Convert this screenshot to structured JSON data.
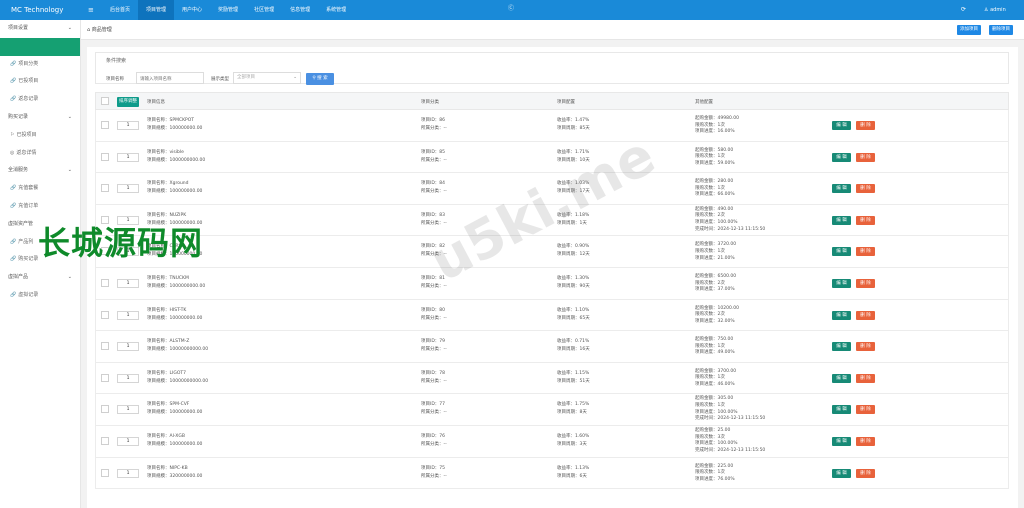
{
  "header": {
    "brand": "MC Technology",
    "menu_icon": "≡",
    "nav": [
      "后台首页",
      "项目管理",
      "用户中心",
      "奖励管理",
      "社区管理",
      "信息管理",
      "系统管理"
    ],
    "active_nav": 1,
    "center_icon": "Ⓒ",
    "refresh_icon": "⟳",
    "user": "admin"
  },
  "sidebar": [
    {
      "label": "项目设置",
      "group": true,
      "chevron": "⌄"
    },
    {
      "label": "",
      "active": true
    },
    {
      "label": "项目分类",
      "icon": "🔗"
    },
    {
      "label": "已投项目",
      "icon": "🔗"
    },
    {
      "label": "返息记录",
      "icon": "🔗"
    },
    {
      "label": "购买记录",
      "group": true,
      "chevron": "⌄"
    },
    {
      "label": "已投项目",
      "icon": "⚐"
    },
    {
      "label": "返息详情",
      "icon": "◎"
    },
    {
      "label": "全消服务",
      "group": true,
      "chevron": "⌄"
    },
    {
      "label": "充值套餐",
      "icon": "🔗"
    },
    {
      "label": "充值订单",
      "icon": "🔗"
    },
    {
      "label": "虚拟资产管",
      "group": true
    },
    {
      "label": "产品列",
      "icon": "🔗"
    },
    {
      "label": "购买记录",
      "icon": "🔗"
    },
    {
      "label": "虚拟产品",
      "group": true,
      "chevron": "⌄"
    },
    {
      "label": "虚拟记录",
      "icon": "🔗"
    }
  ],
  "breadcrumb": {
    "icon": "⌂",
    "text": "商品管理"
  },
  "top_buttons": {
    "add": "添加项目",
    "delete": "删除项目"
  },
  "filter": {
    "title": "条件搜索",
    "name_label": "项目名称",
    "name_placeholder": "请输入项目名称",
    "type_label": "展示类型",
    "type_value": "全部项目",
    "search": "搜 索"
  },
  "table": {
    "sort_button": "排序调整",
    "headers": [
      "项目信息",
      "项目分类",
      "项目配置",
      "其他配置"
    ],
    "label_name": "项目名称：",
    "label_scale": "项目规模：",
    "label_id": "项目ID：",
    "label_cat": "所属分类：",
    "label_rate": "收益率：",
    "label_period": "项目周期：",
    "label_min": "起购金额：",
    "label_times": "限购次数：",
    "label_progress": "项目进度：",
    "label_done": "完成时间：",
    "edit": "编 辑",
    "delete": "删 除",
    "rows": [
      {
        "sort": "1",
        "name": "SPMCKPOT",
        "scale": "100000000.00",
        "id": "86",
        "cat": "--",
        "rate": "1.47%",
        "period": "85天",
        "min": "49980.00",
        "times": "1次",
        "progress": "16.00%"
      },
      {
        "sort": "1",
        "name": "visible",
        "scale": "1000000000.00",
        "id": "85",
        "cat": "--",
        "rate": "1.71%",
        "period": "10天",
        "min": "580.00",
        "times": "1次",
        "progress": "59.00%"
      },
      {
        "sort": "1",
        "name": "Xground",
        "scale": "100000000.00",
        "id": "84",
        "cat": "--",
        "rate": "1.03%",
        "period": "17天",
        "min": "280.00",
        "times": "1次",
        "progress": "66.00%"
      },
      {
        "sort": "1",
        "name": "NUZIPK",
        "scale": "100000000.00",
        "id": "83",
        "cat": "--",
        "rate": "1.18%",
        "period": "1天",
        "min": "490.00",
        "times": "2次",
        "progress": "100.00%",
        "done": "2024-12-13 11:15:50"
      },
      {
        "sort": "1",
        "name": "CTRSP",
        "scale": "100000000.00",
        "id": "82",
        "cat": "--",
        "rate": "0.90%",
        "period": "12天",
        "min": "3720.00",
        "times": "1次",
        "progress": "21.00%"
      },
      {
        "sort": "1",
        "name": "TNUCKM",
        "scale": "1000000000.00",
        "id": "81",
        "cat": "--",
        "rate": "1.30%",
        "period": "90天",
        "min": "6500.00",
        "times": "2次",
        "progress": "37.00%"
      },
      {
        "sort": "1",
        "name": "HIST-TK",
        "scale": "100000000.00",
        "id": "80",
        "cat": "--",
        "rate": "1.10%",
        "period": "65天",
        "min": "10200.00",
        "times": "2次",
        "progress": "32.00%"
      },
      {
        "sort": "1",
        "name": "ALSTM-Z",
        "scale": "10000000000.00",
        "id": "79",
        "cat": "--",
        "rate": "0.71%",
        "period": "16天",
        "min": "750.00",
        "times": "1次",
        "progress": "49.00%"
      },
      {
        "sort": "1",
        "name": "LIGOT7",
        "scale": "10000000000.00",
        "id": "78",
        "cat": "--",
        "rate": "1.15%",
        "period": "51天",
        "min": "3700.00",
        "times": "1次",
        "progress": "46.00%"
      },
      {
        "sort": "1",
        "name": "SPM-CVF",
        "scale": "100000000.00",
        "id": "77",
        "cat": "--",
        "rate": "1.75%",
        "period": "8天",
        "min": "305.00",
        "times": "1次",
        "progress": "100.00%",
        "done": "2024-12-13 11:15:50"
      },
      {
        "sort": "1",
        "name": "AI-XGB",
        "scale": "100000000.00",
        "id": "76",
        "cat": "--",
        "rate": "1.60%",
        "period": "3天",
        "min": "25.00",
        "times": "3次",
        "progress": "100.00%",
        "done": "2024-12-13 11:15:50"
      },
      {
        "sort": "1",
        "name": "NIPC-KB",
        "scale": "320000000.00",
        "id": "75",
        "cat": "--",
        "rate": "1.13%",
        "period": "6天",
        "min": "225.00",
        "times": "1次",
        "progress": "76.00%"
      }
    ]
  },
  "watermark": {
    "cn": "长城源码网",
    "url": "u5ki.me"
  },
  "colors": {
    "topbar": "#1a8ad8",
    "active_green": "#15a072",
    "edit": "#178a76",
    "delete": "#e8623b",
    "search": "#4a90e2"
  }
}
